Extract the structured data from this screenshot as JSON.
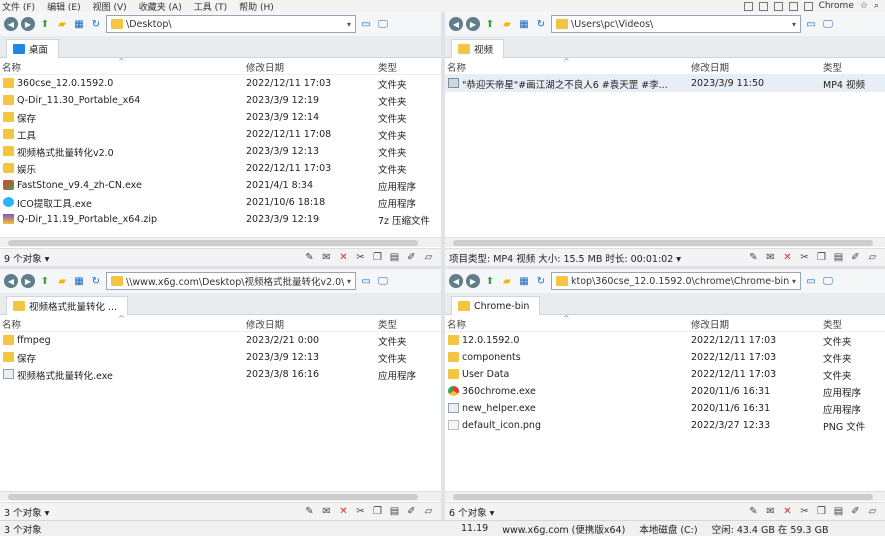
{
  "menu": {
    "items": [
      "文件 (F)",
      "编辑 (E)",
      "视图 (V)",
      "收藏夹 (A)",
      "工具 (T)",
      "帮助 (H)"
    ],
    "right_label": "Chrome"
  },
  "panes": [
    {
      "address": "\\Desktop\\",
      "tab": "桌面",
      "columns": {
        "name": "名称",
        "date": "修改日期",
        "type": "类型"
      },
      "rows": [
        {
          "icon": "folder",
          "name": "360cse_12.0.1592.0",
          "date": "2022/12/11 17:03",
          "type": "文件夹"
        },
        {
          "icon": "folder",
          "name": "Q-Dir_11.30_Portable_x64",
          "date": "2023/3/9 12:19",
          "type": "文件夹"
        },
        {
          "icon": "folder",
          "name": "保存",
          "date": "2023/3/9 12:14",
          "type": "文件夹"
        },
        {
          "icon": "folder",
          "name": "工具",
          "date": "2022/12/11 17:08",
          "type": "文件夹"
        },
        {
          "icon": "folder",
          "name": "视频格式批量转化v2.0",
          "date": "2023/3/9 12:13",
          "type": "文件夹"
        },
        {
          "icon": "folder",
          "name": "娱乐",
          "date": "2022/12/11 17:03",
          "type": "文件夹"
        },
        {
          "icon": "exe",
          "name": "FastStone_v9.4_zh-CN.exe",
          "date": "2021/4/1 8:34",
          "type": "应用程序"
        },
        {
          "icon": "ico",
          "name": "ICO提取工具.exe",
          "date": "2021/10/6 18:18",
          "type": "应用程序"
        },
        {
          "icon": "zip",
          "name": "Q-Dir_11.19_Portable_x64.zip",
          "date": "2023/3/9 12:19",
          "type": "7z 压缩文件"
        }
      ],
      "status": "9 个对象 ▾"
    },
    {
      "address": "\\Users\\pc\\Videos\\",
      "tab": "视频",
      "columns": {
        "name": "名称",
        "date": "修改日期",
        "type": "类型"
      },
      "rows": [
        {
          "icon": "video",
          "name": "\"恭迎天帝星\"#画江湖之不良人6 #袁天罡 #李...",
          "date": "2023/3/9 11:50",
          "type": "MP4 视频"
        }
      ],
      "status": "项目类型: MP4 视频 大小: 15.5 MB 时长: 00:01:02 ▾"
    },
    {
      "address": "\\\\www.x6g.com\\Desktop\\视频格式批量转化v2.0\\",
      "tab": "视频格式批量转化 ...",
      "columns": {
        "name": "名称",
        "date": "修改日期",
        "type": "类型"
      },
      "rows": [
        {
          "icon": "folder",
          "name": "ffmpeg",
          "date": "2023/2/21 0:00",
          "type": "文件夹"
        },
        {
          "icon": "folder",
          "name": "保存",
          "date": "2023/3/9 12:13",
          "type": "文件夹"
        },
        {
          "icon": "app2",
          "name": "视频格式批量转化.exe",
          "date": "2023/3/8 16:16",
          "type": "应用程序"
        }
      ],
      "status": "3 个对象 ▾"
    },
    {
      "address": "ktop\\360cse_12.0.1592.0\\chrome\\Chrome-bin\\",
      "tab": "Chrome-bin",
      "columns": {
        "name": "名称",
        "date": "修改日期",
        "type": "类型"
      },
      "rows": [
        {
          "icon": "folder",
          "name": "12.0.1592.0",
          "date": "2022/12/11 17:03",
          "type": "文件夹"
        },
        {
          "icon": "folder",
          "name": "components",
          "date": "2022/12/11 17:03",
          "type": "文件夹"
        },
        {
          "icon": "folder",
          "name": "User Data",
          "date": "2022/12/11 17:03",
          "type": "文件夹"
        },
        {
          "icon": "chrome",
          "name": "360chrome.exe",
          "date": "2020/11/6 16:31",
          "type": "应用程序"
        },
        {
          "icon": "app2",
          "name": "new_helper.exe",
          "date": "2020/11/6 16:31",
          "type": "应用程序"
        },
        {
          "icon": "png",
          "name": "default_icon.png",
          "date": "2022/3/27 12:33",
          "type": "PNG 文件"
        }
      ],
      "status": "6 个对象 ▾"
    }
  ],
  "bottom": {
    "left": "3 个对象",
    "version": "11.19",
    "site": "www.x6g.com (便携版x64)",
    "drive": "本地磁盘 (C:)",
    "space": "空闲: 43.4 GB 在 59.3 GB"
  },
  "colors": {
    "accent": "#1e88e5",
    "folder": "#f4c542",
    "delete": "#d32f2f"
  }
}
